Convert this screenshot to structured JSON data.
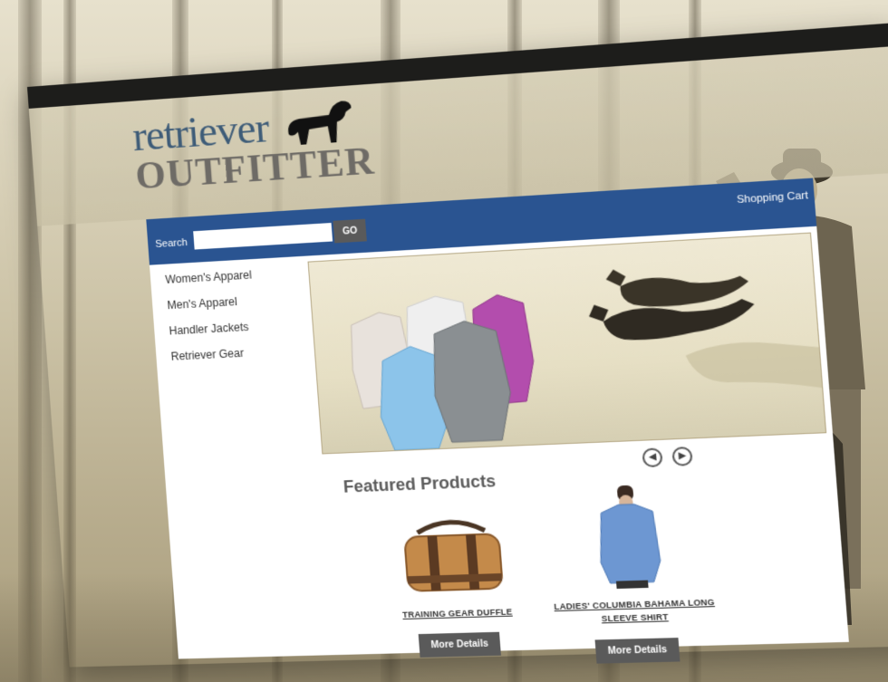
{
  "brand": {
    "logo_line1": "retriever",
    "logo_line2": "OUTFITTER"
  },
  "header": {
    "search_label": "Search",
    "search_placeholder": "",
    "go_label": "GO",
    "cart_label": "Shopping Cart"
  },
  "sidebar": {
    "items": [
      {
        "label": "Women's Apparel"
      },
      {
        "label": "Men's Apparel"
      },
      {
        "label": "Handler Jackets"
      },
      {
        "label": "Retriever Gear"
      }
    ]
  },
  "carousel": {
    "prev_icon": "arrow-left-icon",
    "next_icon": "arrow-right-icon"
  },
  "featured": {
    "title": "Featured Products",
    "products": [
      {
        "name": "TRAINING GEAR DUFFLE",
        "button": "More Details"
      },
      {
        "name": "LADIES' COLUMBIA BAHAMA LONG SLEEVE SHIRT",
        "button": "More Details"
      }
    ]
  },
  "colors": {
    "nav_blue": "#2a5491",
    "button_gray": "#5a5a5a",
    "logo_blue": "#3e5c78",
    "logo_gray": "#6e6b66"
  }
}
